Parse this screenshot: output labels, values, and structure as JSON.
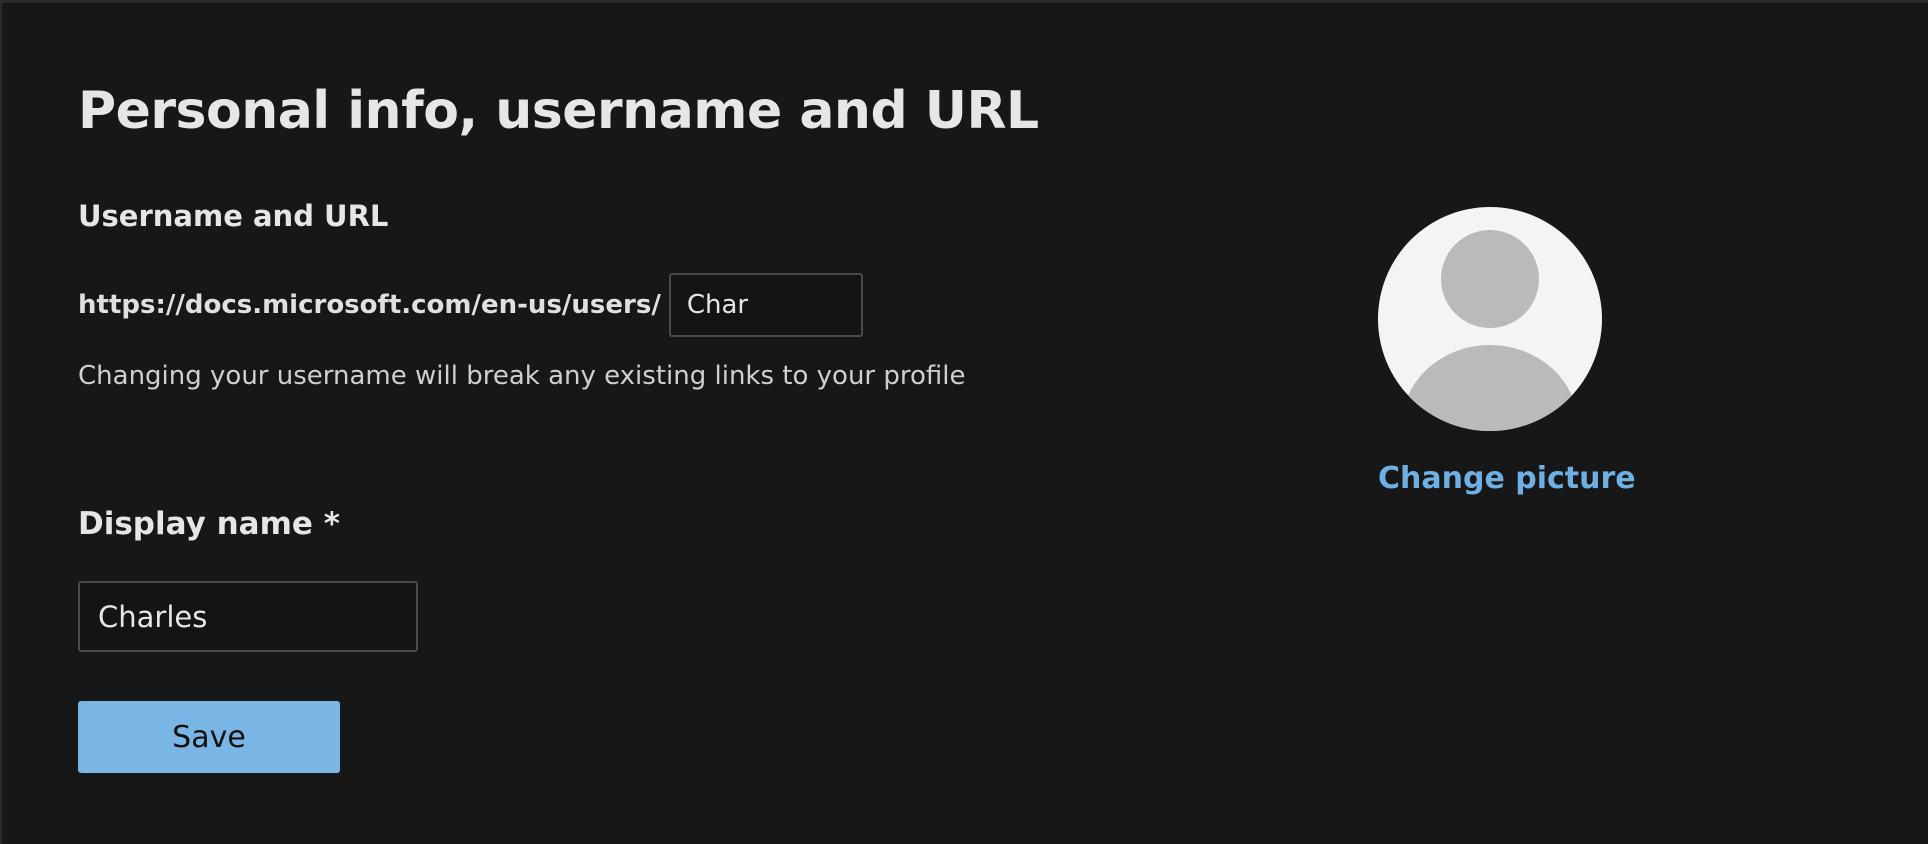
{
  "page": {
    "title": "Personal info, username and URL"
  },
  "username_section": {
    "heading": "Username and URL",
    "url_prefix": "https://docs.microsoft.com/en-us/users/",
    "username_value": "Char",
    "help_text": "Changing your username will break any existing links to your profile"
  },
  "display_name_section": {
    "label": "Display name *",
    "value": "Charles"
  },
  "actions": {
    "save_label": "Save"
  },
  "profile_picture": {
    "icon": "default-avatar-icon",
    "change_label": "Change picture"
  },
  "colors": {
    "background": "#171718",
    "accent": "#79b6e6",
    "link": "#6fb0e4",
    "avatar_bg": "#f3f4f6",
    "avatar_fg": "#b9babb"
  }
}
